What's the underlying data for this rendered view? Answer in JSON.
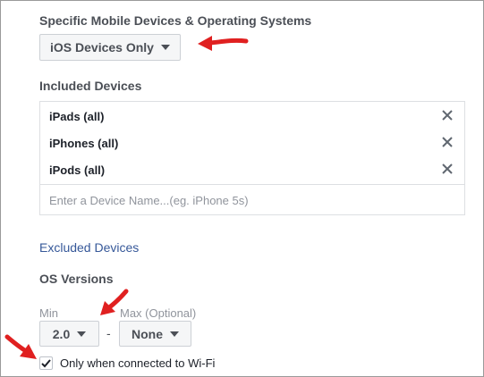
{
  "section_title": "Specific Mobile Devices & Operating Systems",
  "platform_select": {
    "value": "iOS Devices Only"
  },
  "included": {
    "title": "Included Devices",
    "items": [
      {
        "label": "iPads (all)"
      },
      {
        "label": "iPhones (all)"
      },
      {
        "label": "iPods (all)"
      }
    ],
    "input_placeholder": "Enter a Device Name...(eg. iPhone 5s)"
  },
  "excluded_link": "Excluded Devices",
  "os_versions": {
    "title": "OS Versions",
    "min_label": "Min",
    "max_label": "Max (Optional)",
    "min_value": "2.0",
    "separator": "-",
    "max_value": "None"
  },
  "wifi": {
    "label": "Only when connected to Wi-Fi",
    "checked": true
  },
  "colors": {
    "link": "#365899",
    "arrow": "#e02020",
    "text": "#4b4f56"
  }
}
